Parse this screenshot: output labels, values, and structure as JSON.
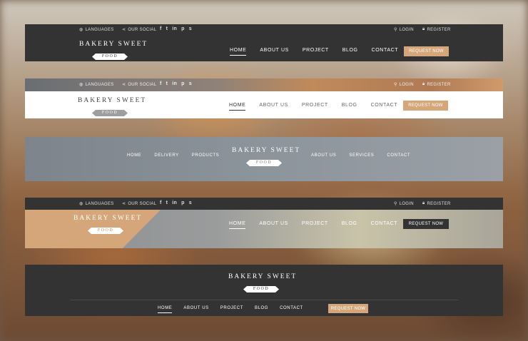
{
  "common": {
    "brand_line1": "BAKERY SWEET",
    "brand_line2": "FOOD",
    "languages": "LANGUAGES",
    "our_social": "OUR SOCIAL",
    "login": "LOGIN",
    "register": "REGISTER",
    "request_now": "REQUEST NOW",
    "social_icons": [
      "f",
      "t",
      "in",
      "p",
      "s"
    ]
  },
  "nav": [
    "HOME",
    "ABOUT US",
    "PROJECT",
    "BLOG",
    "CONTACT"
  ],
  "nav_split_left": [
    "HOME",
    "DELIVERY",
    "PRODUCTS"
  ],
  "nav_split_right": [
    "ABOUT US",
    "SERVICES",
    "CONTACT"
  ],
  "colors": {
    "dark": "#333333",
    "accent": "#d5a679",
    "white": "#ffffff",
    "grey_pill": "#9e9e9e",
    "blue_grey": "#8c949c"
  },
  "icons": {
    "globe": "globe-icon",
    "share": "share-icon",
    "search": "search-icon",
    "lock": "lock-icon"
  }
}
